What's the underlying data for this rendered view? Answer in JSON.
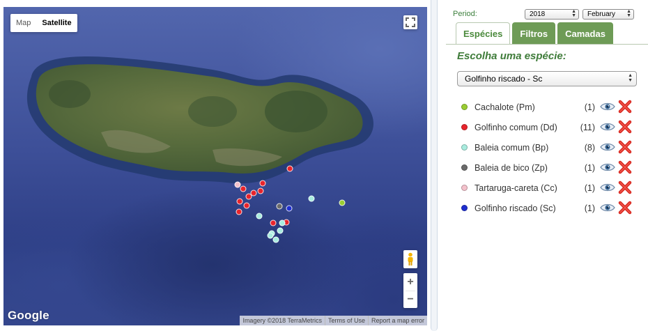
{
  "map": {
    "type_buttons": [
      {
        "label": "Map",
        "active": false
      },
      {
        "label": "Satellite",
        "active": true
      }
    ],
    "zoom_in": "+",
    "zoom_out": "−",
    "logo": "Google",
    "attribution": [
      "Imagery ©2018 TerraMetrics",
      "Terms of Use",
      "Report a map error"
    ],
    "marker_colors": {
      "Pm": "#9acd32",
      "Dd": "#e8242c",
      "Bp": "#a9ecdf",
      "Zp": "#6b6b6b",
      "Cc": "#f4c2cc",
      "Sc": "#1f2fd0"
    }
  },
  "panel": {
    "period_label": "Period:",
    "year": "2018",
    "month": "February",
    "tabs": [
      {
        "label": "Espécies",
        "active": true
      },
      {
        "label": "Filtros",
        "active": false
      },
      {
        "label": "Camadas",
        "active": false
      }
    ],
    "choose_label": "Escolha uma espécie:",
    "selected_species": "Golfinho riscado - Sc",
    "species": [
      {
        "name": "Cachalote (Pm)",
        "count": "(1)",
        "color": "#9acd32"
      },
      {
        "name": "Golfinho comum (Dd)",
        "count": "(11)",
        "color": "#e8242c"
      },
      {
        "name": "Baleia comum (Bp)",
        "count": "(8)",
        "color": "#a9ecdf"
      },
      {
        "name": "Baleia de bico (Zp)",
        "count": "(1)",
        "color": "#6b6b6b"
      },
      {
        "name": "Tartaruga-careta (Cc)",
        "count": "(1)",
        "color": "#f4c2cc"
      },
      {
        "name": "Golfinho riscado (Sc)",
        "count": "(1)",
        "color": "#1f2fd0"
      }
    ],
    "icons": {
      "view": "eye-icon",
      "delete": "red-x-icon"
    }
  }
}
